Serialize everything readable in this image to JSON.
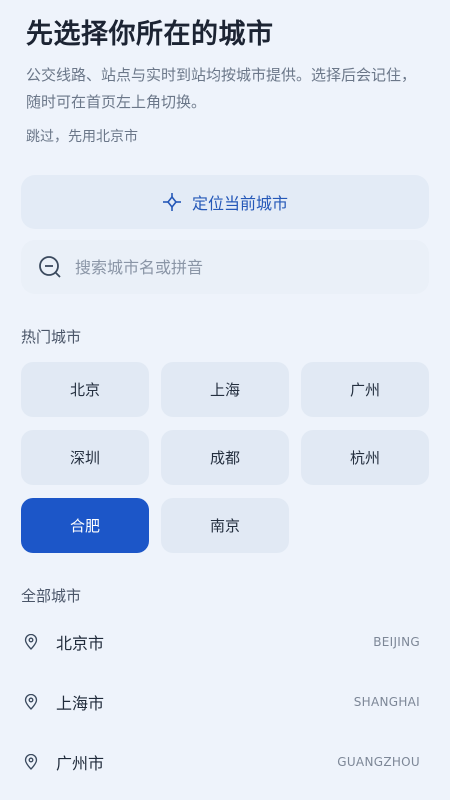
{
  "header": {
    "title": "先选择你所在的城市",
    "description": "公交线路、站点与实时到站均按城市提供。选择后会记住，随时可在首页左上角切换。",
    "skip_text": "跳过，先用北京市"
  },
  "locate": {
    "label": "定位当前城市",
    "icon": "locate-icon"
  },
  "search": {
    "placeholder": "搜索城市名或拼音",
    "value": "",
    "icon": "search-icon"
  },
  "hot": {
    "label": "热门城市",
    "cities": [
      {
        "name": "北京",
        "selected": false
      },
      {
        "name": "上海",
        "selected": false
      },
      {
        "name": "广州",
        "selected": false
      },
      {
        "name": "深圳",
        "selected": false
      },
      {
        "name": "成都",
        "selected": false
      },
      {
        "name": "杭州",
        "selected": false
      },
      {
        "name": "合肥",
        "selected": true
      },
      {
        "name": "南京",
        "selected": false
      }
    ]
  },
  "all": {
    "label": "全部城市",
    "cities": [
      {
        "name": "北京市",
        "pinyin": "BEIJING"
      },
      {
        "name": "上海市",
        "pinyin": "SHANGHAI"
      },
      {
        "name": "广州市",
        "pinyin": "GUANGZHOU"
      }
    ]
  },
  "colors": {
    "accent": "#1c56c8",
    "background": "#eef3fb",
    "chip": "#e1e9f4"
  }
}
